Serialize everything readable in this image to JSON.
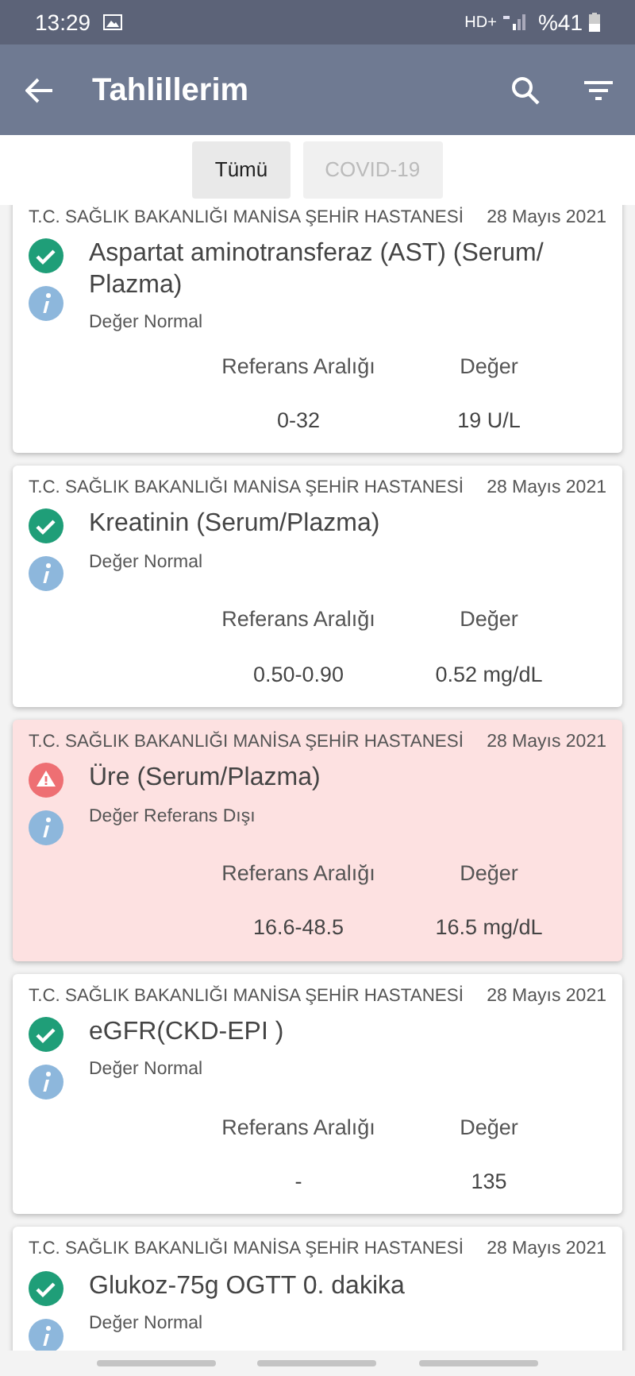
{
  "status_bar": {
    "time": "13:29",
    "network": "HD+",
    "battery": "%41"
  },
  "app_bar": {
    "title": "Tahlillerim"
  },
  "tabs": [
    {
      "label": "Tümü",
      "selected": true
    },
    {
      "label": "COVID-19",
      "selected": false
    }
  ],
  "results": [
    {
      "hospital": "T.C. SAĞLIK BAKANLIĞI MANİSA ŞEHİR HASTANESİ",
      "date": "28 Mayıs 2021",
      "test": "Aspartat aminotransferaz (AST) (Serum/ Plazma)",
      "kind": "normal",
      "status_text": "Değer Normal",
      "range_label": "Referans Aralığı",
      "value_label": "Değer",
      "range": "0-32",
      "value": "19 U/L"
    },
    {
      "hospital": "T.C. SAĞLIK BAKANLIĞI MANİSA ŞEHİR HASTANESİ",
      "date": "28 Mayıs 2021",
      "test": "Kreatinin (Serum/Plazma)",
      "kind": "normal",
      "status_text": "Değer Normal",
      "range_label": "Referans Aralığı",
      "value_label": "Değer",
      "range": "0.50-0.90",
      "value": "0.52 mg/dL"
    },
    {
      "hospital": "T.C. SAĞLIK BAKANLIĞI MANİSA ŞEHİR HASTANESİ",
      "date": "28 Mayıs 2021",
      "test": "Üre (Serum/Plazma)",
      "kind": "abnormal",
      "status_text": "Değer Referans Dışı",
      "range_label": "Referans Aralığı",
      "value_label": "Değer",
      "range": "16.6-48.5",
      "value": "16.5 mg/dL"
    },
    {
      "hospital": "T.C. SAĞLIK BAKANLIĞI MANİSA ŞEHİR HASTANESİ",
      "date": "28 Mayıs 2021",
      "test": "eGFR(CKD-EPI )",
      "kind": "normal",
      "status_text": "Değer Normal",
      "range_label": "Referans Aralığı",
      "value_label": "Değer",
      "range": "-",
      "value": "135"
    },
    {
      "hospital": "T.C. SAĞLIK BAKANLIĞI MANİSA ŞEHİR HASTANESİ",
      "date": "28 Mayıs 2021",
      "test": "Glukoz-75g OGTT 0. dakika",
      "kind": "normal",
      "status_text": "Değer Normal"
    }
  ]
}
